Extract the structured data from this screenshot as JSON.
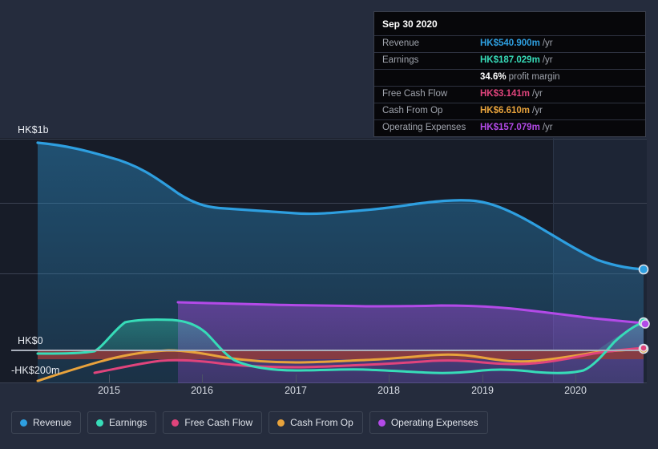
{
  "colors": {
    "background": "#252c3d",
    "plot_past": "#171c28",
    "plot_future": "#1d2535",
    "gridline": "#3b4252",
    "zero_line": "#aab0bc",
    "revenue": "#2e9fe0",
    "earnings": "#37dcb8",
    "free_cash_flow": "#e0447c",
    "cash_from_op": "#e8a33c",
    "operating_expenses": "#b34ae8",
    "negative_fill": "#8e3b3b"
  },
  "tooltip": {
    "date": "Sep 30 2020",
    "rows": [
      {
        "label": "Revenue",
        "value": "HK$540.900m",
        "unit": "/yr",
        "color": "#2e9fe0"
      },
      {
        "label": "Earnings",
        "value": "HK$187.029m",
        "unit": "/yr",
        "color": "#37dcb8"
      },
      {
        "label": "",
        "margin_value": "34.6%",
        "margin_text": "profit margin"
      },
      {
        "label": "Free Cash Flow",
        "value": "HK$3.141m",
        "unit": "/yr",
        "color": "#e0447c"
      },
      {
        "label": "Cash From Op",
        "value": "HK$6.610m",
        "unit": "/yr",
        "color": "#e8a33c"
      },
      {
        "label": "Operating Expenses",
        "value": "HK$157.079m",
        "unit": "/yr",
        "color": "#b34ae8"
      }
    ]
  },
  "legend": {
    "items": [
      {
        "label": "Revenue",
        "color": "#2e9fe0"
      },
      {
        "label": "Earnings",
        "color": "#37dcb8"
      },
      {
        "label": "Free Cash Flow",
        "color": "#e0447c"
      },
      {
        "label": "Cash From Op",
        "color": "#e8a33c"
      },
      {
        "label": "Operating Expenses",
        "color": "#b34ae8"
      }
    ]
  },
  "axes": {
    "y_labels": [
      {
        "text": "HK$1b",
        "value": 1000
      },
      {
        "text": "HK$0",
        "value": 0
      },
      {
        "text": "-HK$200m",
        "value": -200
      }
    ],
    "x_labels": [
      "2015",
      "2016",
      "2017",
      "2018",
      "2019",
      "2020"
    ]
  },
  "chart_data": {
    "type": "area",
    "title": "",
    "xlabel": "",
    "ylabel": "",
    "currency": "HK$",
    "unit": "millions",
    "ylim": [
      -260,
      1060
    ],
    "y_ticks": [
      1000,
      800,
      600,
      400,
      200,
      0,
      -200
    ],
    "y_tick_labels": [
      "HK$1b",
      "",
      "",
      "",
      "",
      "HK$0",
      "-HK$200m"
    ],
    "grid": true,
    "legend_position": "bottom",
    "x": [
      "2014.55",
      "2015",
      "2015.5",
      "2016",
      "2016.5",
      "2017",
      "2017.5",
      "2018",
      "2018.5",
      "2019",
      "2019.5",
      "2020",
      "2020.75"
    ],
    "series": [
      {
        "name": "Revenue",
        "color": "#2e9fe0",
        "values": [
          1012,
          975,
          930,
          830,
          800,
          780,
          772,
          775,
          790,
          780,
          720,
          640,
          541
        ]
      },
      {
        "name": "Earnings",
        "color": "#37dcb8",
        "values": [
          -8,
          -8,
          130,
          138,
          50,
          -60,
          -78,
          -90,
          -82,
          -100,
          -118,
          -90,
          187
        ]
      },
      {
        "name": "Free Cash Flow",
        "color": "#e0447c",
        "values": [
          -30,
          -48,
          -80,
          -95,
          -102,
          -100,
          -98,
          -95,
          -88,
          -86,
          -90,
          -70,
          3
        ]
      },
      {
        "name": "Cash From Op",
        "color": "#e8a33c",
        "values": [
          -205,
          -150,
          -95,
          -72,
          -88,
          -92,
          -90,
          -80,
          -62,
          -60,
          -78,
          -56,
          7
        ]
      },
      {
        "name": "Operating Expenses",
        "color": "#b34ae8",
        "values": [
          null,
          null,
          null,
          210,
          205,
          200,
          198,
          200,
          202,
          198,
          190,
          175,
          157
        ]
      }
    ],
    "forecast_divider_x": "2019.8",
    "annotations": [
      {
        "type": "tooltip",
        "x": "2020.75",
        "label": "Sep 30 2020"
      }
    ]
  }
}
